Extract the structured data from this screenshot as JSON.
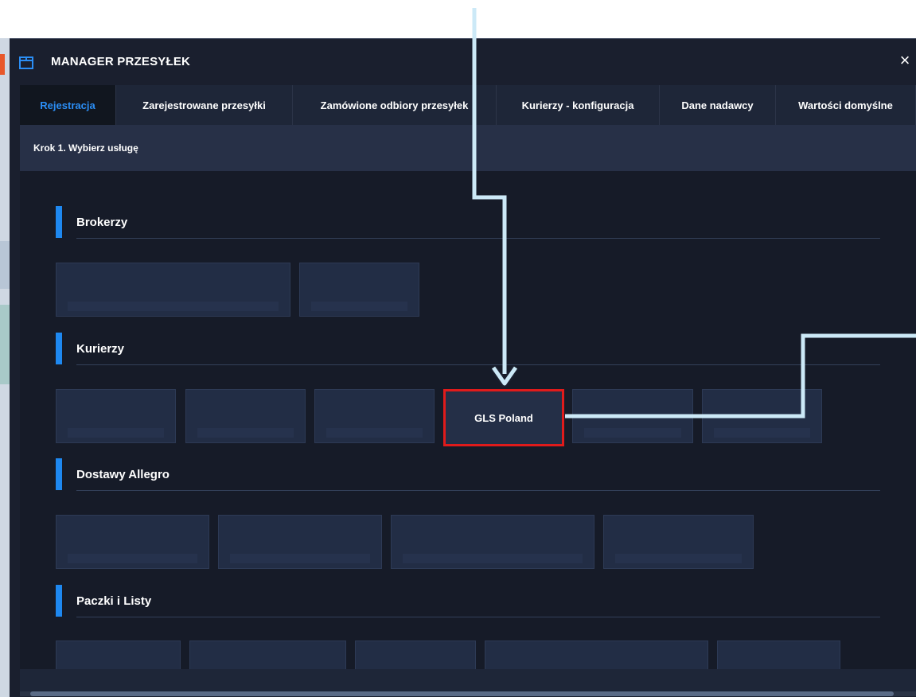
{
  "window": {
    "title": "MANAGER PRZESYŁEK",
    "close_label": "×"
  },
  "tabs": [
    {
      "label": "Rejestracja",
      "active": true
    },
    {
      "label": "Zarejestrowane przesyłki",
      "active": false
    },
    {
      "label": "Zamówione odbiory przesyłek",
      "active": false
    },
    {
      "label": "Kurierzy - konfiguracja",
      "active": false
    },
    {
      "label": "Dane nadawcy",
      "active": false
    },
    {
      "label": "Wartości domyślne",
      "active": false
    }
  ],
  "step": {
    "label": "Krok 1. Wybierz usługę"
  },
  "sections": [
    {
      "title": "Brokerzy"
    },
    {
      "title": "Kurierzy"
    },
    {
      "title": "Dostawy Allegro"
    },
    {
      "title": "Paczki i Listy"
    }
  ],
  "couriers": {
    "highlighted_label": "GLS Poland"
  },
  "colors": {
    "background": "#1a1f2e",
    "tab_bar": "#1e2638",
    "active_tab_text": "#2b8ef5",
    "section_accent": "#1e88f0",
    "highlight_border": "#e01b1b",
    "annotation_arrow": "#cce9f7"
  },
  "icons": {
    "title": "package-icon",
    "close": "close-icon"
  }
}
